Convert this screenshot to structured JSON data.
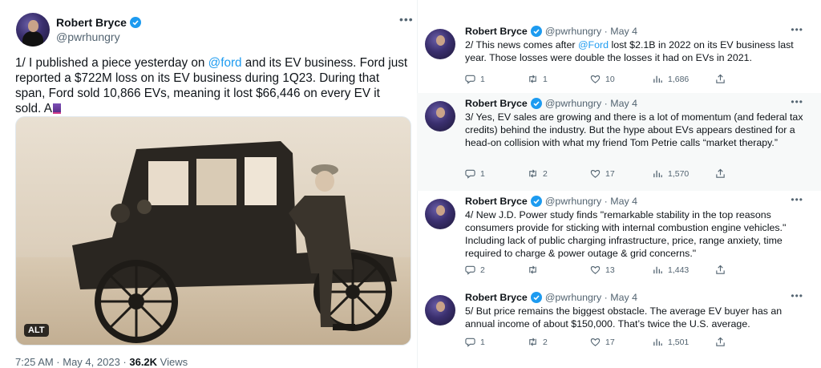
{
  "main_tweet": {
    "author_name": "Robert Bryce",
    "author_handle": "@pwrhungry",
    "more_icon": "more-horizontal-icon",
    "text_part1": "1/ I published a piece yesterday on ",
    "mention": "@ford",
    "text_part2": " and its EV business. Ford just reported a $722M loss on its EV business during 1Q23. During that span, Ford sold 10,866 EVs, meaning it lost $66,446 on every EV it sold. A",
    "image_alt_label": "ALT",
    "timestamp": "7:25 AM · May 4, 2023 · ",
    "views_count": "36.2K",
    "views_label": " Views"
  },
  "replies": [
    {
      "author_name": "Robert Bryce",
      "author_handle": "@pwrhungry · May 4",
      "text_part1": "2/ This news comes after ",
      "mention": "@Ford",
      "text_part2": " lost $2.1B in 2022 on its EV business last year. Those losses were double the losses it had on EVs in 2021.",
      "replies_count": "1",
      "retweets_count": "1",
      "likes_count": "10",
      "views_count": "1,686"
    },
    {
      "author_name": "Robert Bryce",
      "author_handle": "@pwrhungry · May 4",
      "text": "3/ Yes, EV sales are growing and there is a lot of momentum (and federal tax credits) behind the industry. But the hype about EVs appears destined for a head-on collision with what my friend Tom Petrie calls “market therapy.”",
      "replies_count": "1",
      "retweets_count": "2",
      "likes_count": "17",
      "views_count": "1,570"
    },
    {
      "author_name": "Robert Bryce",
      "author_handle": "@pwrhungry · May 4",
      "text": "4/ New J.D. Power study finds \"remarkable stability in the top reasons consumers provide for sticking with internal combustion engine vehicles.\" Including lack of public charging infrastructure, price, range anxiety, time required to charge & power outage & grid concerns.\"",
      "replies_count": "2",
      "retweets_count": "",
      "likes_count": "13",
      "views_count": "1,443"
    },
    {
      "author_name": "Robert Bryce",
      "author_handle": "@pwrhungry · May 4",
      "text": "5/ But price remains the biggest obstacle. The average EV buyer has an annual income of about $150,000. That’s twice the U.S. average.",
      "replies_count": "1",
      "retweets_count": "2",
      "likes_count": "17",
      "views_count": "1,501"
    }
  ],
  "colors": {
    "link": "#1d9bf0",
    "secondary_text": "#536471",
    "shaded_row": "#f7f9f9"
  },
  "icons": [
    "verified-badge-icon",
    "reply-icon",
    "retweet-icon",
    "like-icon",
    "views-icon",
    "share-icon",
    "more-horizontal-icon"
  ]
}
